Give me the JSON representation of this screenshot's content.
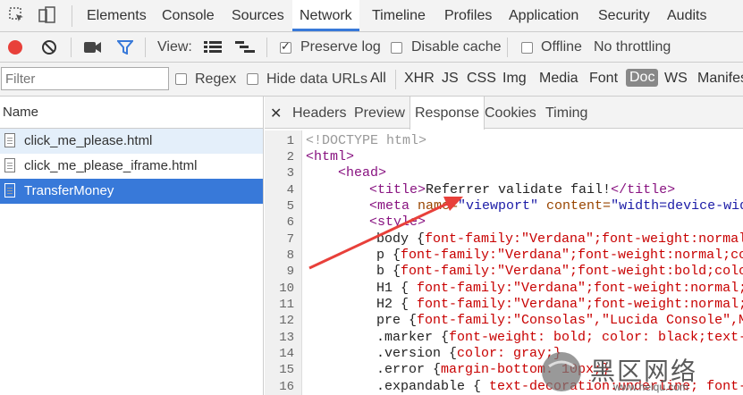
{
  "devtools_tabs": [
    "Elements",
    "Console",
    "Sources",
    "Network",
    "Timeline",
    "Profiles",
    "Application",
    "Security",
    "Audits"
  ],
  "toolbar": {
    "view_label": "View:",
    "preserve_log": "Preserve log",
    "disable_cache": "Disable cache",
    "offline": "Offline",
    "throttling": "No throttling"
  },
  "filter": {
    "placeholder": "Filter",
    "regex": "Regex",
    "hide_data_urls": "Hide data URLs",
    "types": [
      "All",
      "XHR",
      "JS",
      "CSS",
      "Img",
      "Media",
      "Font",
      "Doc",
      "WS",
      "Manifes"
    ]
  },
  "requests": {
    "header": "Name",
    "items": [
      "click_me_please.html",
      "click_me_please_iframe.html",
      "TransferMoney"
    ]
  },
  "detail_tabs": [
    "Headers",
    "Preview",
    "Response",
    "Cookies",
    "Timing"
  ],
  "code": {
    "line_numbers": [
      "1",
      "2",
      "3",
      "4",
      "5",
      "6",
      "7",
      "8",
      "9",
      "10",
      "11",
      "12",
      "13",
      "14",
      "15",
      "16"
    ],
    "l1": "<!DOCTYPE html>",
    "l2_open": "<html>",
    "l3_open": "<head>",
    "l4_tag_open": "<title>",
    "l4_text": "Referrer validate fail!",
    "l4_tag_close": "</title>",
    "l5_tag": "<meta ",
    "l5_attr1": "name=",
    "l5_val1": "\"viewport\"",
    "l5_attr2": " content=",
    "l5_val2": "\"width=device-width",
    "l6_tag": "<style>",
    "l7_sel": "body {",
    "l7_rest": "font-family:\"Verdana\";font-weight:normal;f",
    "l8_sel": "p {",
    "l8_rest": "font-family:\"Verdana\";font-weight:normal;colo",
    "l9_sel": "b {",
    "l9_rest": "font-family:\"Verdana\";font-weight:bold;color",
    "l10_sel": "H1 { ",
    "l10_rest": "font-family:\"Verdana\";font-weight:normal;fo",
    "l11_sel": "H2 { ",
    "l11_rest": "font-family:\"Verdana\";font-weight:normal;fo",
    "l12_sel": "pre {",
    "l12_rest": "font-family:\"Consolas\",\"Lucida Console\",Mon",
    "l13_sel": ".marker {",
    "l13_rest": "font-weight: bold; color: black;text-de",
    "l14_sel": ".version {",
    "l14_rest": "color: gray;}",
    "l15_sel": ".error {",
    "l15_rest": "margin-bottom: 10px;}",
    "l16_sel": ".expandable { ",
    "l16_rest": "text-decoration:underline; font-we"
  },
  "watermark": {
    "text": "黑区网络",
    "url": "www.heiqu.com"
  },
  "colors": {
    "accent": "#3879d9",
    "selected_row": "#3879d9",
    "hover_row": "#e4effa",
    "arrow": "#e8403a",
    "record": "#e8403a"
  }
}
